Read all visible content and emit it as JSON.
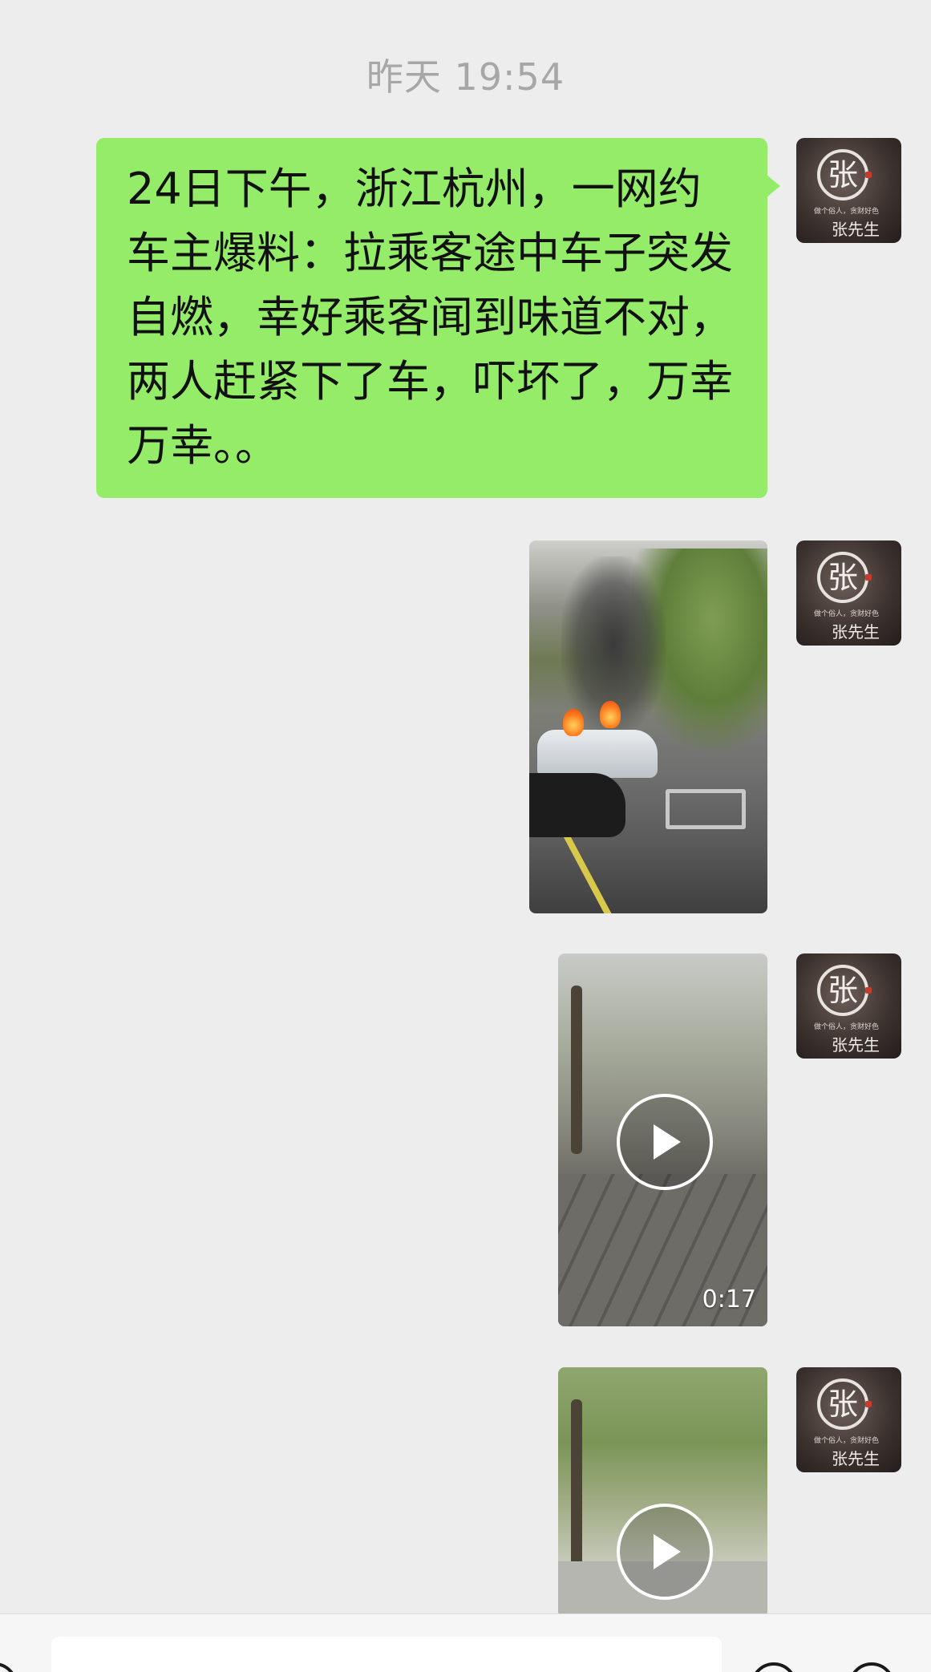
{
  "chat": {
    "timestamp": "昨天 19:54",
    "messages": [
      {
        "type": "text",
        "sender": "张先生",
        "text": "24日下午，浙江杭州，一网约车主爆料：拉乘客途中车子突发自燃，幸好乘客闻到味道不对，两人赶紧下了车，吓坏了，万幸万幸。。"
      },
      {
        "type": "image",
        "sender": "张先生"
      },
      {
        "type": "video",
        "sender": "张先生",
        "duration": "0:17"
      },
      {
        "type": "video",
        "sender": "张先生"
      }
    ]
  },
  "avatar": {
    "glyph": "张",
    "slogan": "做个俗人，贪财好色",
    "name": "张先生"
  },
  "colors": {
    "background": "#ededed",
    "bubble_self": "#95ec69",
    "timestamp": "#a7a7a7"
  },
  "icons": [
    "play-icon",
    "voice-icon",
    "emoji-icon",
    "more-icon"
  ]
}
